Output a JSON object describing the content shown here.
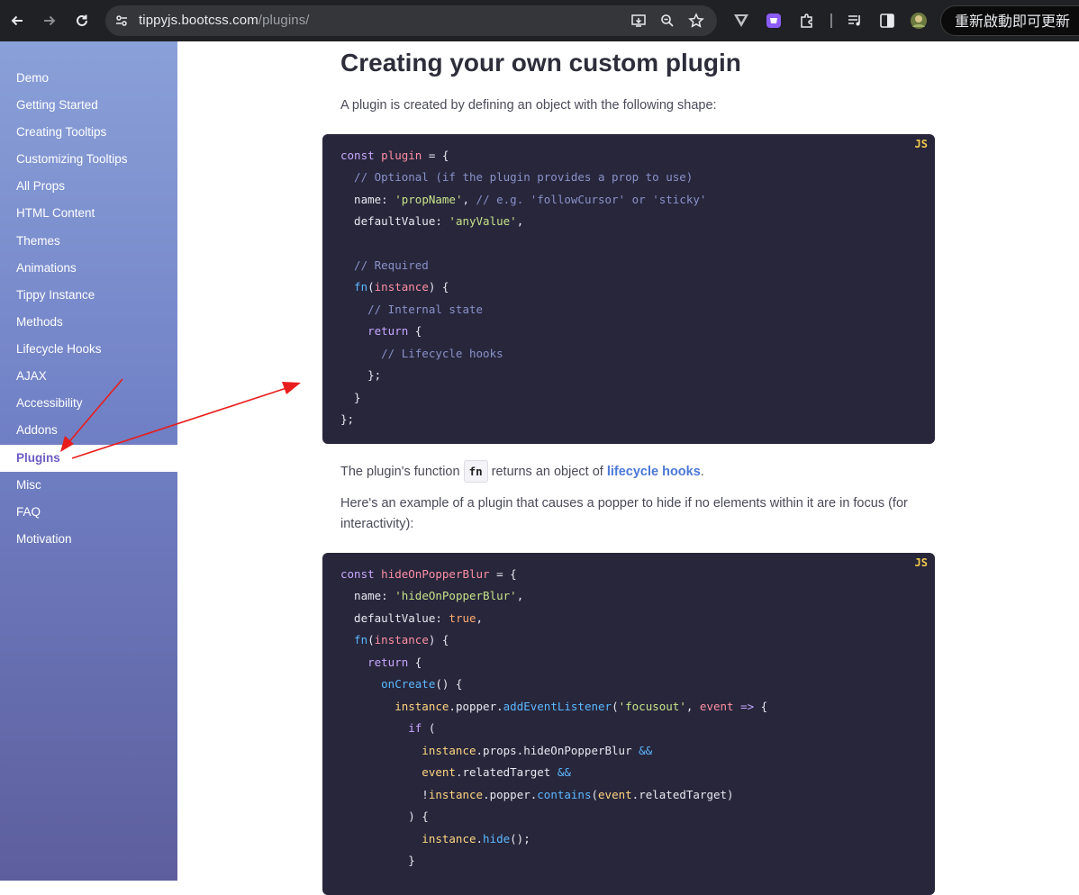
{
  "browser": {
    "url_host": "tippyjs.bootcss.com",
    "url_path": "/plugins/",
    "update_button": "重新啟動即可更新"
  },
  "sidebar": {
    "items": [
      {
        "label": "Demo"
      },
      {
        "label": "Getting Started"
      },
      {
        "label": "Creating Tooltips"
      },
      {
        "label": "Customizing Tooltips"
      },
      {
        "label": "All Props"
      },
      {
        "label": "HTML Content"
      },
      {
        "label": "Themes"
      },
      {
        "label": "Animations"
      },
      {
        "label": "Tippy Instance"
      },
      {
        "label": "Methods"
      },
      {
        "label": "Lifecycle Hooks"
      },
      {
        "label": "AJAX"
      },
      {
        "label": "Accessibility"
      },
      {
        "label": "Addons"
      },
      {
        "label": "Plugins",
        "active": true
      },
      {
        "label": "Misc"
      },
      {
        "label": "FAQ"
      },
      {
        "label": "Motivation"
      }
    ]
  },
  "main": {
    "heading": "Creating your own custom plugin",
    "intro": "A plugin is created by defining an object with the following shape:",
    "code1_lang": "JS",
    "fn_text_before": "The plugin's function ",
    "fn_code": "fn",
    "fn_text_middle": " returns an object of ",
    "fn_link": "lifecycle hooks",
    "fn_text_after": ".",
    "example_text": "Here's an example of a plugin that causes a popper to hide if no elements within it are in focus (for interactivity):",
    "code2_lang": "JS"
  },
  "code1": {
    "l1_kw": "const",
    "l1_var": "plugin",
    "l1_rest": " = {",
    "l2": "  // Optional (if the plugin provides a prop to use)",
    "l3_prop": "  name: ",
    "l3_str": "'propName'",
    "l3_rest": ", ",
    "l3_com": "// e.g. 'followCursor' or 'sticky'",
    "l4_prop": "  defaultValue: ",
    "l4_str": "'anyValue'",
    "l4_rest": ",",
    "l6": "  // Required",
    "l7_fn": "  fn",
    "l7_p1": "(",
    "l7_arg": "instance",
    "l7_p2": ") {",
    "l8": "    // Internal state",
    "l9_kw": "    return",
    "l9_rest": " {",
    "l10": "      // Lifecycle hooks",
    "l11": "    };",
    "l12": "  }",
    "l13": "};"
  },
  "code2": {
    "l1_kw": "const",
    "l1_var": "hideOnPopperBlur",
    "l1_rest": " = {",
    "l2_prop": "  name: ",
    "l2_str": "'hideOnPopperBlur'",
    "l2_rest": ",",
    "l3_prop": "  defaultValue: ",
    "l3_true": "true",
    "l3_rest": ",",
    "l4_fn": "  fn",
    "l4_p1": "(",
    "l4_arg": "instance",
    "l4_p2": ") {",
    "l5_kw": "    return",
    "l5_rest": " {",
    "l6_fn": "      onCreate",
    "l6_rest": "() {",
    "l7_id": "        instance",
    "l7_a": ".popper.",
    "l7_fn": "addEventListener",
    "l7_b": "(",
    "l7_str": "'focusout'",
    "l7_c": ", ",
    "l7_ev": "event",
    "l7_d": " ",
    "l7_arrow": "=>",
    "l7_e": " {",
    "l8_kw": "          if",
    "l8_rest": " (",
    "l9_id": "            instance",
    "l9_a": ".props.hideOnPopperBlur ",
    "l9_op": "&&",
    "l10_id": "            event",
    "l10_a": ".relatedTarget ",
    "l10_op": "&&",
    "l11_a": "            !",
    "l11_id": "instance",
    "l11_b": ".popper.",
    "l11_fn": "contains",
    "l11_c": "(",
    "l11_ev": "event",
    "l11_d": ".relatedTarget)",
    "l12": "          ) {",
    "l13_id": "            instance",
    "l13_a": ".",
    "l13_fn": "hide",
    "l13_b": "();",
    "l14": "          }"
  }
}
